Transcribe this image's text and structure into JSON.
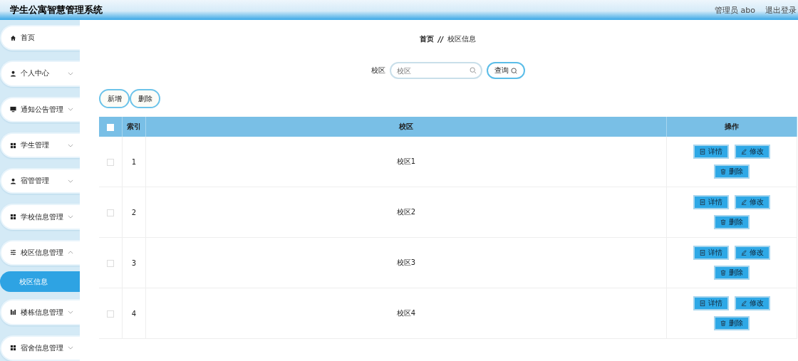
{
  "header": {
    "title": "学生公寓智慧管理系统",
    "user": "管理员 abo",
    "logout": "退出登录"
  },
  "sidebar": {
    "items": [
      {
        "label": "首页",
        "kind": "link"
      },
      {
        "label": "个人中心",
        "kind": "menu",
        "expanded": false
      },
      {
        "label": "通知公告管理",
        "kind": "menu",
        "expanded": false
      },
      {
        "label": "学生管理",
        "kind": "menu",
        "expanded": false
      },
      {
        "label": "宿管管理",
        "kind": "menu",
        "expanded": false
      },
      {
        "label": "学校信息管理",
        "kind": "menu",
        "expanded": false
      },
      {
        "label": "校区信息管理",
        "kind": "menu",
        "expanded": true,
        "children": [
          {
            "label": "校区信息",
            "selected": true
          }
        ]
      },
      {
        "label": "楼栋信息管理",
        "kind": "menu",
        "expanded": false
      },
      {
        "label": "宿舍信息管理",
        "kind": "menu",
        "expanded": false
      }
    ]
  },
  "breadcrumb": {
    "items": [
      "首页",
      "校区信息"
    ],
    "separator": "//"
  },
  "search": {
    "label": "校区",
    "placeholder": "校区",
    "button": "查询"
  },
  "actions": [
    "新增",
    "删除"
  ],
  "table": {
    "select_all_checked": false,
    "columns": [
      "索引",
      "校区",
      "操作"
    ],
    "rows": [
      {
        "index": "1",
        "campus": "校区1",
        "checked": false,
        "actions": [
          "详情",
          "修改",
          "删除"
        ]
      },
      {
        "index": "2",
        "campus": "校区2",
        "checked": false,
        "actions": [
          "详情",
          "修改",
          "删除"
        ]
      },
      {
        "index": "3",
        "campus": "校区3",
        "checked": false,
        "actions": [
          "详情",
          "修改",
          "删除"
        ]
      },
      {
        "index": "4",
        "campus": "校区4",
        "checked": false,
        "actions": [
          "详情",
          "修改",
          "删除"
        ]
      }
    ]
  }
}
